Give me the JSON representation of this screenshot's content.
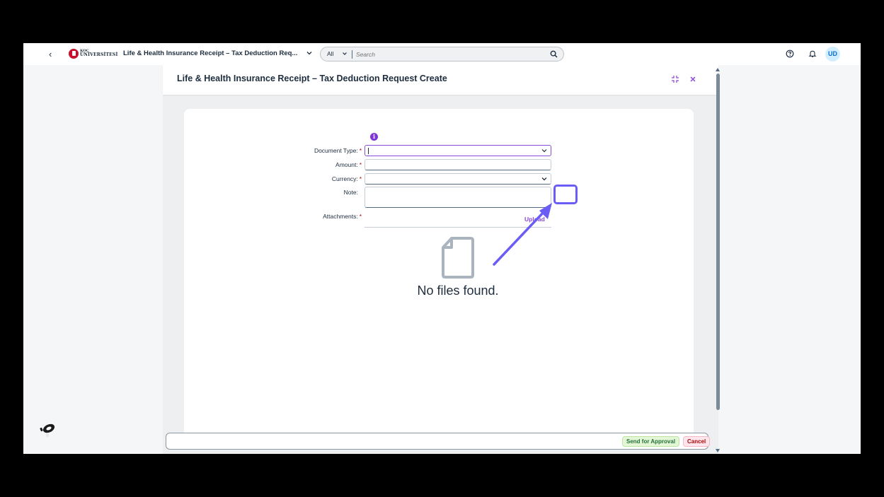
{
  "shell": {
    "logo_line1": "KOÇ",
    "logo_line2": "ÜNİVERSİTESİ",
    "app_title": "Life & Health Insurance Receipt – Tax Deduction Req...",
    "search_scope": "All",
    "search_placeholder": "Search",
    "avatar_initials": "UD"
  },
  "dialog": {
    "title": "Life & Health Insurance Receipt – Tax Deduction Request Create",
    "form": {
      "document_type_label": "Document Type:",
      "document_type_value": "",
      "amount_label": "Amount:",
      "amount_value": "",
      "currency_label": "Currency:",
      "currency_value": "",
      "note_label": "Note:",
      "note_value": "",
      "attachments_label": "Attachments:",
      "required_marker": "*",
      "upload_label": "Upload"
    },
    "empty_state": "No files found.",
    "footer": {
      "send_label": "Send for Approval",
      "cancel_label": "Cancel"
    }
  },
  "colors": {
    "accent": "#8d4bdb",
    "annotation": "#6a5cf5",
    "approve_bg": "#e3f7d6",
    "cancel_bg": "#ffe5ec"
  }
}
